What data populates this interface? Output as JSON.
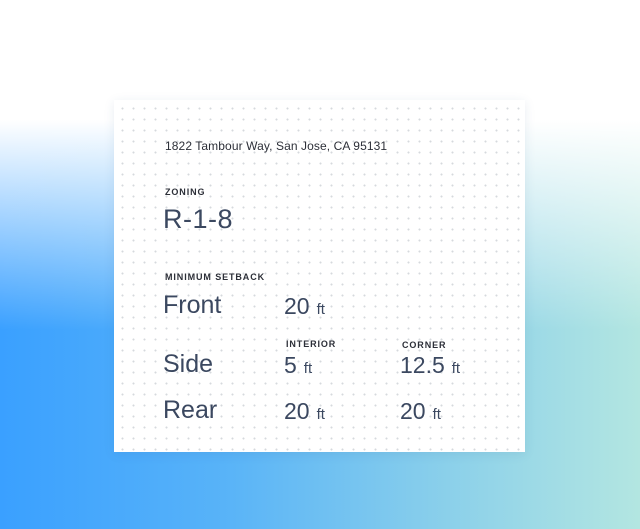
{
  "address": "1822 Tambour Way, San Jose, CA 95131",
  "zoning": {
    "label": "ZONING",
    "value": "R-1-8"
  },
  "setback": {
    "label": "MINIMUM SETBACK",
    "unit": "ft",
    "interior_label": "INTERIOR",
    "corner_label": "CORNER",
    "front": {
      "name": "Front",
      "value": "20"
    },
    "side": {
      "name": "Side",
      "interior": "5",
      "corner": "12.5"
    },
    "rear": {
      "name": "Rear",
      "interior": "20",
      "corner": "20"
    }
  },
  "colors": {
    "text_dark": "#2c2f38",
    "value_text": "#3b4860",
    "gradient_blue": "#3aa0ff",
    "gradient_teal": "#b3e6e1"
  }
}
